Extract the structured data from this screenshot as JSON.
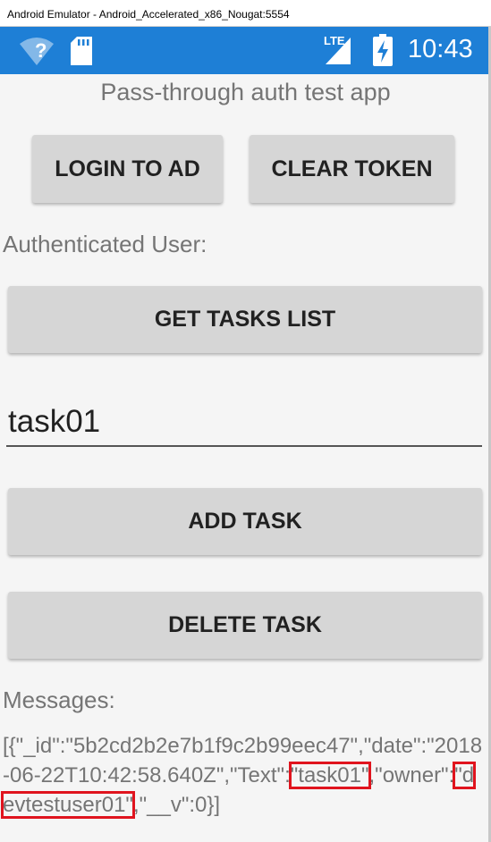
{
  "window": {
    "title": "Android Emulator - Android_Accelerated_x86_Nougat:5554"
  },
  "statusbar": {
    "wifi_label": "?",
    "network_label": "LTE",
    "clock": "10:43",
    "color": "#1e7fd6"
  },
  "app": {
    "title": "Pass-through auth test app"
  },
  "buttons": {
    "login": "LOGIN TO AD",
    "clear_token": "CLEAR TOKEN",
    "get_tasks": "GET TASKS LIST",
    "add_task": "ADD TASK",
    "delete_task": "DELETE TASK"
  },
  "labels": {
    "authenticated_user": "Authenticated User:",
    "messages": "Messages:"
  },
  "task_input": {
    "value": "task01"
  },
  "messages_output": {
    "prefix": "[{\"_id\":\"5b2cd2b2e7b1f9c2b99eec47\",\"date\":\"2018-06-22T10:42:58.640Z\",\"Text\":",
    "text_value": "\"task01\"",
    "middle": ",\"owner\":",
    "owner_value": "\"devtestuser01\"",
    "suffix": ",\"__v\":0}]"
  },
  "highlight_color": "#e0141e"
}
